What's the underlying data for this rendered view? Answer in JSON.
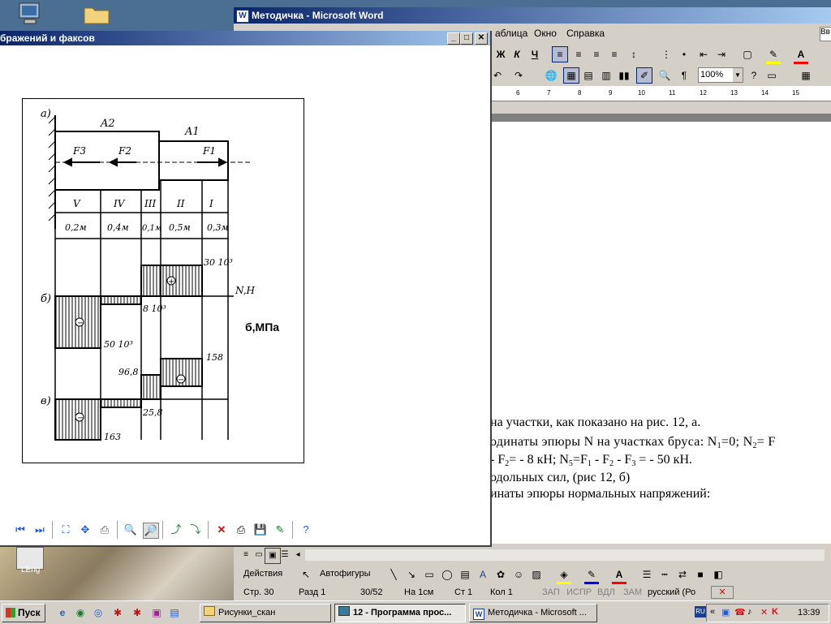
{
  "word": {
    "title": "Методичка - Microsoft Word",
    "menu": [
      "аблица",
      "Окно",
      "Справка"
    ],
    "zoom": "100%",
    "ruler_ticks": [
      "6",
      "7",
      "8",
      "9",
      "10",
      "11",
      "12",
      "13",
      "14",
      "15"
    ],
    "doc_lines": [
      "на участки, как показано на рис. 12, а.",
      "одинаты эпюры N на участках бруса: N",
      "- F",
      "одольных сил, (рис 12, б)",
      "инаты эпюры нормальных напряжений:"
    ],
    "doc_line1_tail": "=0; N",
    "doc_line1_sub1": "1",
    "doc_line1_sub2": "2",
    "doc_line1_end": "= F",
    "doc_line2_parts": {
      "a": "- F",
      "sub_a": "2",
      "b": "= - 8 кН;  N",
      "sub_b": "5",
      "c": "=F",
      "sub_c": "1",
      "d": " - F",
      "sub_d": "2",
      "e": " - F",
      "sub_e": "3",
      "f": " = - 50 кН."
    },
    "draw_actions": "Действия",
    "draw_autoshapes": "Автофигуры",
    "status": {
      "page": "Стр.  30",
      "section": "Разд  1",
      "pages": "30/52",
      "at": "На  1см",
      "line": "Ст  1",
      "col": "Кол  1",
      "rec": "ЗАП",
      "trk": "ИСПР",
      "ext": "ВДЛ",
      "ovr": "ЗАМ",
      "lang": "русский (Ро"
    }
  },
  "viewer": {
    "title": "бражений и факсов",
    "figure": {
      "labels": {
        "a": "a)",
        "b": "б)",
        "v": "в)",
        "A2": "A2",
        "A1": "A1",
        "F3": "F3",
        "F2": "F2",
        "F1": "F1",
        "sections": [
          "V",
          "IV",
          "III",
          "II",
          "I"
        ],
        "lengths": [
          "0,2м",
          "0,4м",
          "0,1м",
          "0,5м",
          "0,3м"
        ],
        "n_axis": "N,H",
        "sigma": "б,МПа",
        "v30": "30 10³",
        "v8": "8 10³",
        "v50": "50 10³",
        "v158": "158",
        "v968": "96,8",
        "v258": "25,8",
        "v163": "163"
      }
    }
  },
  "desktop_icons": [
    {
      "name": "Мой компьютер",
      "label": ""
    },
    {
      "name": "Папка",
      "label": ""
    }
  ],
  "taskbar": {
    "start": "Пуск",
    "tasks": [
      "Рисунки_скан",
      "12 - Программа прос...",
      "Методичка - Microsoft ..."
    ],
    "time": "13:39",
    "lang": "RU"
  },
  "desktop_label": "LEng"
}
